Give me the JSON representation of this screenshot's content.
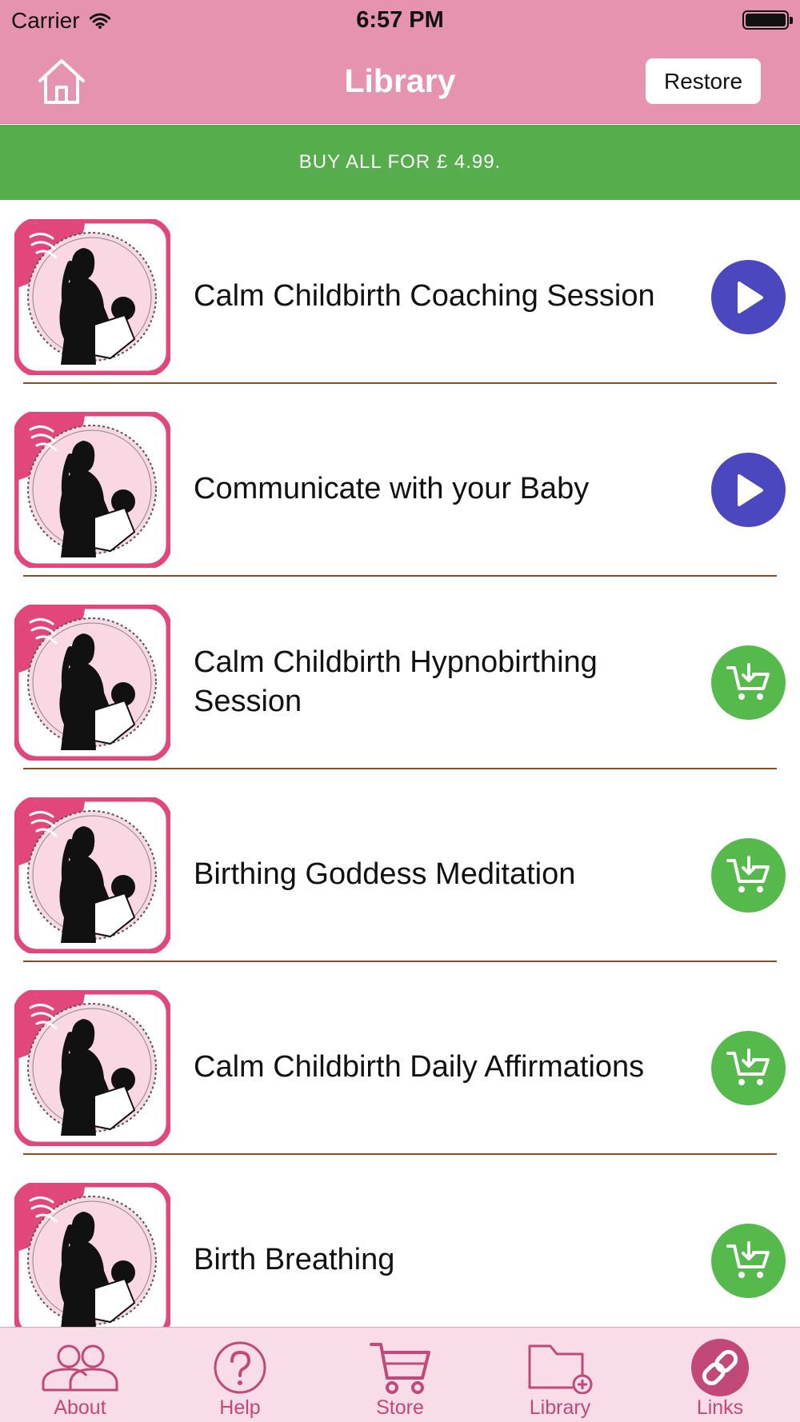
{
  "status_bar": {
    "carrier": "Carrier",
    "time": "6:57 PM"
  },
  "nav": {
    "title": "Library",
    "restore_label": "Restore"
  },
  "banner": {
    "text": "BUY ALL FOR £ 4.99."
  },
  "colors": {
    "nav_pink": "#e593ae",
    "banner_green": "#55ad4b",
    "play_blue": "#4a47bf",
    "buy_green": "#55b94b",
    "tab_pink": "#c2487a",
    "divider_brown": "#8a4b25"
  },
  "items": [
    {
      "title": "Calm Childbirth Coaching Session",
      "action": "play"
    },
    {
      "title": "Communicate with your Baby",
      "action": "play"
    },
    {
      "title": "Calm Childbirth Hypnobirthing Session",
      "action": "buy"
    },
    {
      "title": "Birthing Goddess Meditation",
      "action": "buy"
    },
    {
      "title": "Calm Childbirth Daily Affirmations",
      "action": "buy"
    },
    {
      "title": "Birth Breathing",
      "action": "buy"
    }
  ],
  "tabs": [
    {
      "label": "About",
      "icon": "people-icon"
    },
    {
      "label": "Help",
      "icon": "question-icon"
    },
    {
      "label": "Store",
      "icon": "cart-icon"
    },
    {
      "label": "Library",
      "icon": "folder-add-icon"
    },
    {
      "label": "Links",
      "icon": "link-icon",
      "selected": true
    }
  ]
}
